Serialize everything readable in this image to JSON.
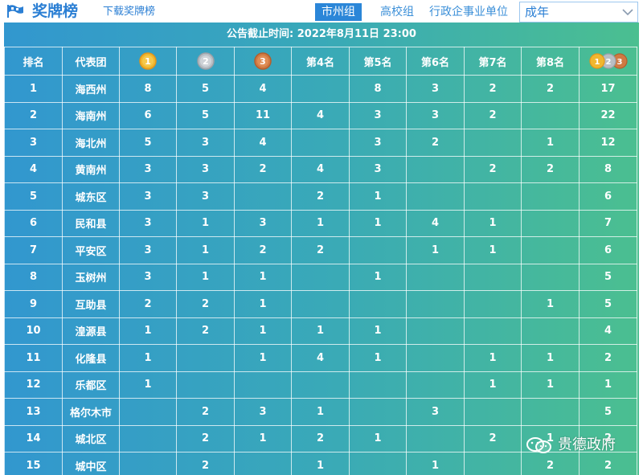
{
  "header": {
    "title": "奖牌榜",
    "download_label": "下载奖牌榜",
    "tabs": [
      {
        "label": "市州组",
        "active": true
      },
      {
        "label": "高校组",
        "active": false
      },
      {
        "label": "行政企事业单位",
        "active": false
      }
    ],
    "select_value": "成年"
  },
  "notice": "公告截止时间: 2022年8月11日 23:00",
  "table": {
    "columns": [
      "排名",
      "代表团",
      "gold-medal-icon",
      "silver-medal-icon",
      "bronze-medal-icon",
      "第4名",
      "第5名",
      "第6名",
      "第7名",
      "第8名",
      "total-medals-icon"
    ],
    "medal_labels": [
      "1",
      "2",
      "3"
    ],
    "rows": [
      [
        "1",
        "海西州",
        "8",
        "5",
        "4",
        "",
        "8",
        "3",
        "2",
        "2",
        "17"
      ],
      [
        "2",
        "海南州",
        "6",
        "5",
        "11",
        "4",
        "3",
        "3",
        "2",
        "",
        "22"
      ],
      [
        "3",
        "海北州",
        "5",
        "3",
        "4",
        "",
        "3",
        "2",
        "",
        "1",
        "12"
      ],
      [
        "4",
        "黄南州",
        "3",
        "3",
        "2",
        "4",
        "3",
        "",
        "2",
        "2",
        "8"
      ],
      [
        "5",
        "城东区",
        "3",
        "3",
        "",
        "2",
        "1",
        "",
        "",
        "",
        "6"
      ],
      [
        "6",
        "民和县",
        "3",
        "1",
        "3",
        "1",
        "1",
        "4",
        "1",
        "",
        "7"
      ],
      [
        "7",
        "平安区",
        "3",
        "1",
        "2",
        "2",
        "",
        "1",
        "1",
        "",
        "6"
      ],
      [
        "8",
        "玉树州",
        "3",
        "1",
        "1",
        "",
        "1",
        "",
        "",
        "",
        "5"
      ],
      [
        "9",
        "互助县",
        "2",
        "2",
        "1",
        "",
        "",
        "",
        "",
        "1",
        "5"
      ],
      [
        "10",
        "湟源县",
        "1",
        "2",
        "1",
        "1",
        "1",
        "",
        "",
        "",
        "4"
      ],
      [
        "11",
        "化隆县",
        "1",
        "",
        "1",
        "4",
        "1",
        "",
        "1",
        "1",
        "2"
      ],
      [
        "12",
        "乐都区",
        "1",
        "",
        "",
        "",
        "",
        "",
        "1",
        "1",
        "1"
      ],
      [
        "13",
        "格尔木市",
        "",
        "2",
        "3",
        "1",
        "",
        "3",
        "",
        "",
        "5"
      ],
      [
        "14",
        "城北区",
        "",
        "2",
        "1",
        "2",
        "1",
        "",
        "2",
        "1",
        "2"
      ],
      [
        "15",
        "城中区",
        "",
        "2",
        "",
        "1",
        "",
        "1",
        "",
        "2",
        "2"
      ]
    ]
  },
  "watermark": "贵德政府",
  "colors": {
    "gold": "#f0b72f",
    "silver": "#b9bec4",
    "bronze": "#d07a43",
    "accent": "#2b86d8"
  }
}
